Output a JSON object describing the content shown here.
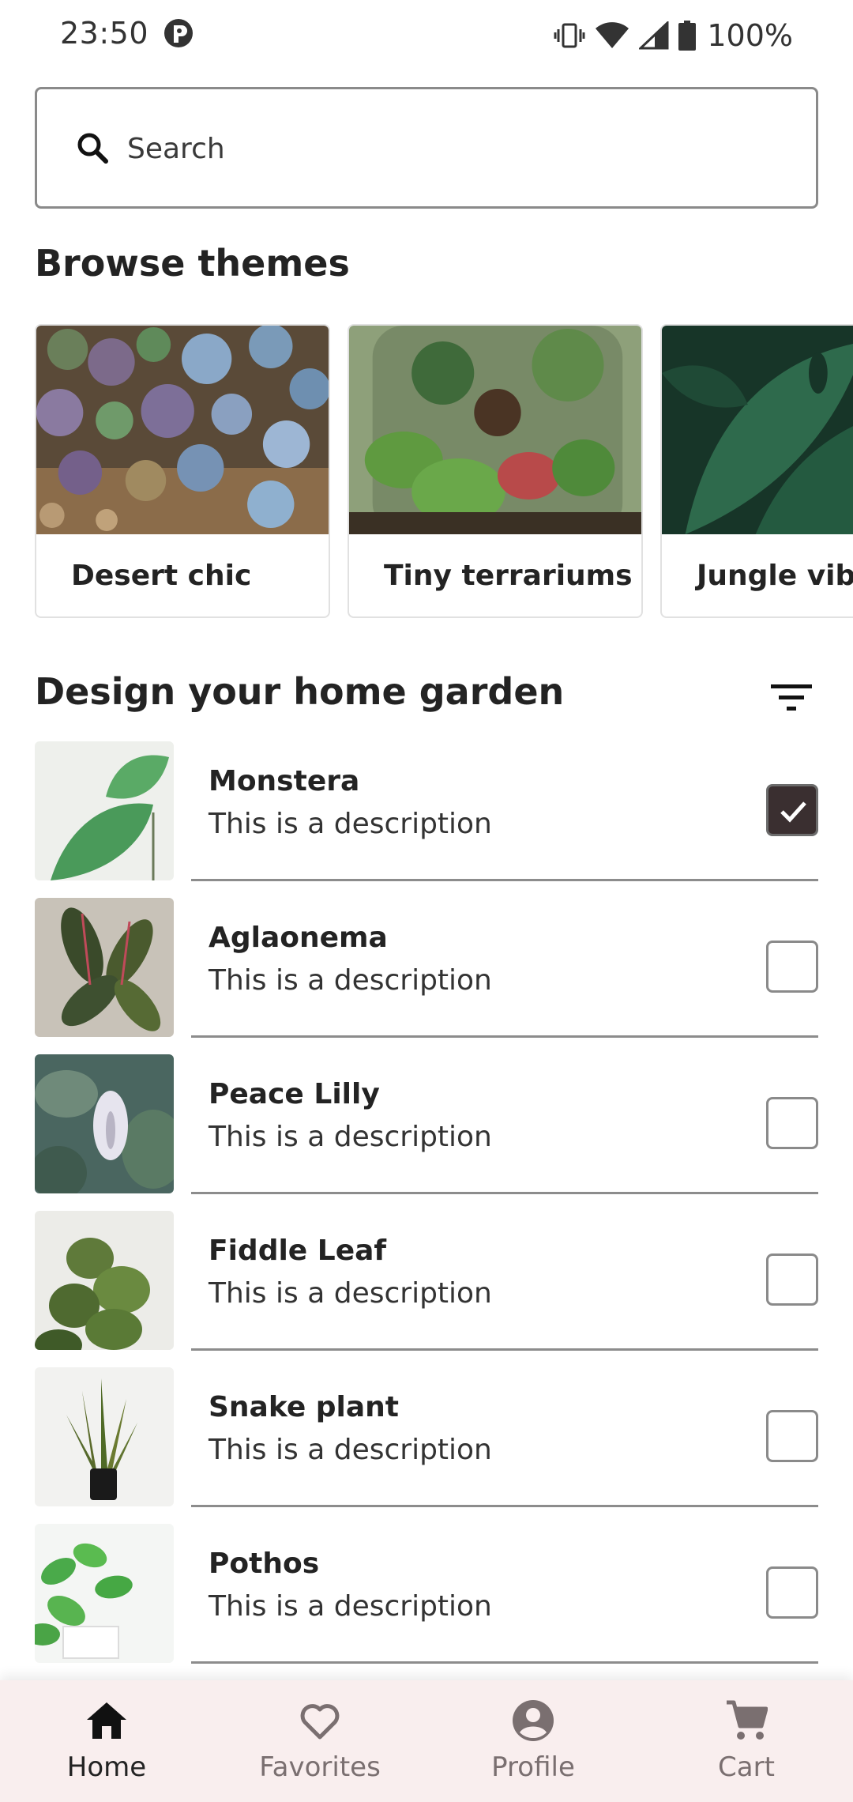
{
  "status_bar": {
    "time": "23:50",
    "battery": "100%"
  },
  "search": {
    "placeholder": "Search"
  },
  "browse": {
    "heading": "Browse themes",
    "themes": [
      {
        "label": "Desert chic"
      },
      {
        "label": "Tiny terrariums"
      },
      {
        "label": "Jungle vibes"
      }
    ]
  },
  "garden": {
    "heading": "Design your home garden",
    "plants": [
      {
        "name": "Monstera",
        "description": "This is a description",
        "checked": true
      },
      {
        "name": "Aglaonema",
        "description": "This is a description",
        "checked": false
      },
      {
        "name": "Peace Lilly",
        "description": "This is a description",
        "checked": false
      },
      {
        "name": "Fiddle Leaf",
        "description": "This is a description",
        "checked": false
      },
      {
        "name": "Snake plant",
        "description": "This is a description",
        "checked": false
      },
      {
        "name": "Pothos",
        "description": "This is a description",
        "checked": false
      }
    ]
  },
  "nav": {
    "items": [
      {
        "label": "Home",
        "icon": "home-icon",
        "active": true
      },
      {
        "label": "Favorites",
        "icon": "heart-icon",
        "active": false
      },
      {
        "label": "Profile",
        "icon": "account-circle-icon",
        "active": false
      },
      {
        "label": "Cart",
        "icon": "shopping-cart-icon",
        "active": false
      }
    ]
  }
}
